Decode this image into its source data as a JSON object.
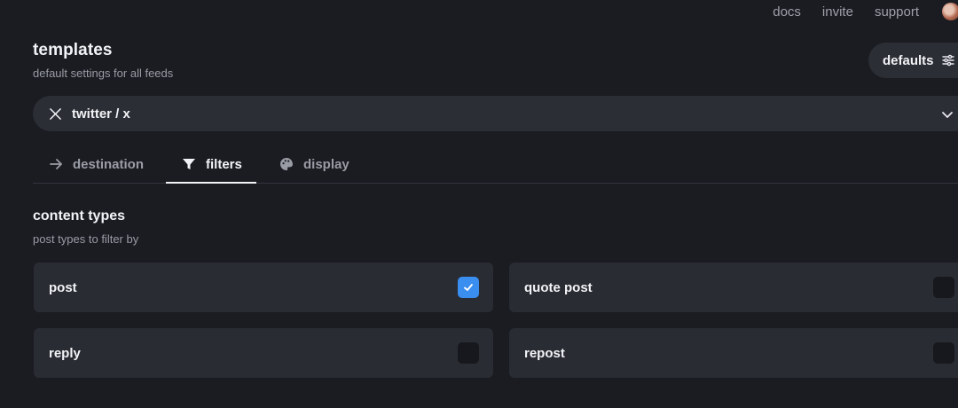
{
  "topnav": {
    "links": [
      "docs",
      "invite",
      "support"
    ]
  },
  "header": {
    "title": "templates",
    "subtitle": "default settings for all feeds",
    "defaults_label": "defaults",
    "defaults_icon": "sliders-icon"
  },
  "platform": {
    "selected": "twitter / x",
    "icon": "x-logo-icon"
  },
  "tabs": [
    {
      "label": "destination",
      "icon": "arrow-right-icon",
      "active": false
    },
    {
      "label": "filters",
      "icon": "filter-icon",
      "active": true
    },
    {
      "label": "display",
      "icon": "palette-icon",
      "active": false
    }
  ],
  "content_types": {
    "title": "content types",
    "subtitle": "post types to filter by",
    "options": [
      {
        "label": "post",
        "checked": true
      },
      {
        "label": "quote post",
        "checked": false
      },
      {
        "label": "reply",
        "checked": false
      },
      {
        "label": "repost",
        "checked": false
      }
    ]
  },
  "colors": {
    "background": "#1b1c22",
    "surface": "#2a2c34",
    "accent": "#3a8ef0"
  }
}
